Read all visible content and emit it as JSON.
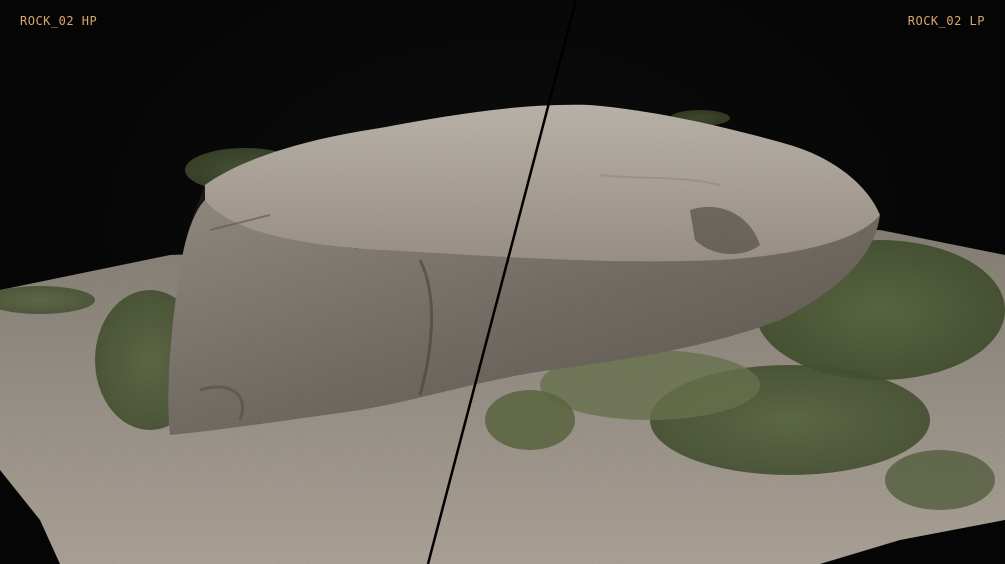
{
  "viewer": {
    "left_label": "ROCK_02 HP",
    "right_label": "ROCK_02 LP",
    "label_color": "#d8a86a",
    "background_color": "#050505"
  },
  "scene": {
    "subject": "rock-scan-model",
    "ground_color": "#8f877c",
    "rock_color": "#a39a8f",
    "grass_color": "#4c5a36"
  }
}
